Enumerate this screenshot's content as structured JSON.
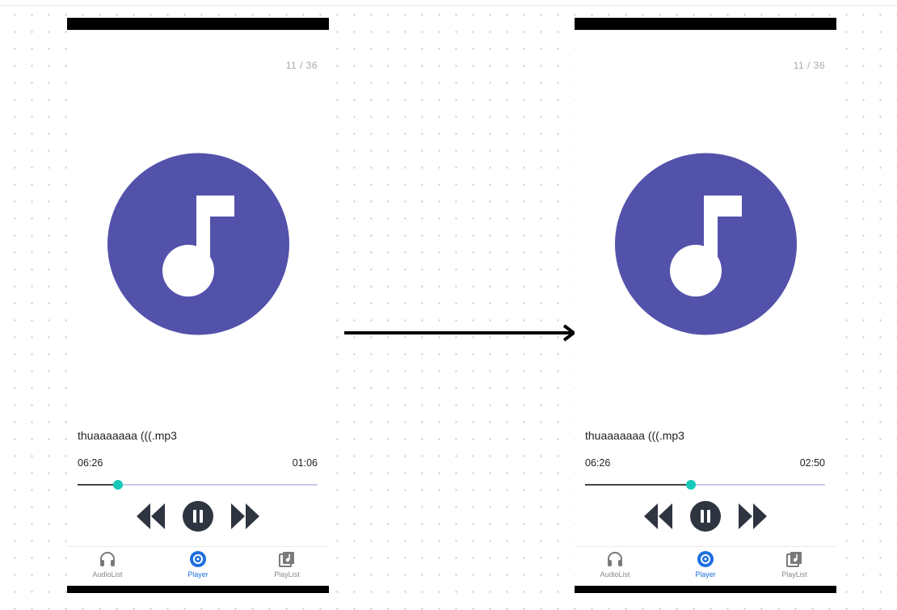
{
  "colors": {
    "album_art": "#5352ab",
    "seek_thumb": "#17c9b8",
    "seek_track": "#c9c6ec",
    "seek_fill": "#444444",
    "control_icon": "#2e3440",
    "nav_active": "#1e6fe0",
    "nav_inactive": "#8a8a8a"
  },
  "screens": [
    {
      "track_counter": "11 / 36",
      "album_art_icon": "music-note-icon",
      "track_title": "thuaaaaaaa (((.mp3",
      "time_left": "06:26",
      "time_right": "01:06",
      "progress_fraction": 0.17,
      "controls": {
        "prev_icon": "rewind-icon",
        "play_icon": "pause-icon",
        "next_icon": "fast-forward-icon"
      },
      "nav": [
        {
          "label": "AudioList",
          "icon": "headphones-icon",
          "active": false
        },
        {
          "label": "Player",
          "icon": "player-disc-icon",
          "active": true
        },
        {
          "label": "PlayList",
          "icon": "playlist-icon",
          "active": false
        }
      ]
    },
    {
      "track_counter": "11 / 36",
      "album_art_icon": "music-note-icon",
      "track_title": "thuaaaaaaa (((.mp3",
      "time_left": "06:26",
      "time_right": "02:50",
      "progress_fraction": 0.44,
      "controls": {
        "prev_icon": "rewind-icon",
        "play_icon": "pause-icon",
        "next_icon": "fast-forward-icon"
      },
      "nav": [
        {
          "label": "AudioList",
          "icon": "headphones-icon",
          "active": false
        },
        {
          "label": "Player",
          "icon": "player-disc-icon",
          "active": true
        },
        {
          "label": "PlayList",
          "icon": "playlist-icon",
          "active": false
        }
      ]
    }
  ],
  "transition_icon": "right-arrow-icon"
}
